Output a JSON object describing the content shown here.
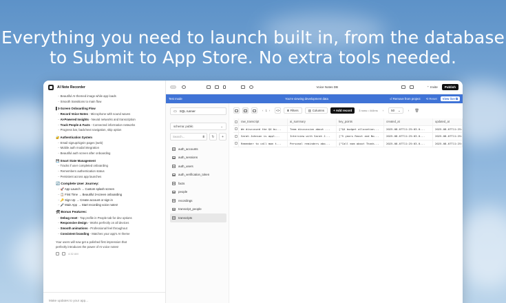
{
  "headline": {
    "line1": "Everything you need to launch built in, from the database",
    "line2": "to Submit to App Store. No extra tools needed."
  },
  "chat": {
    "app_name": "AI Note Recorder",
    "lines": [
      {
        "type": "sub",
        "text": "Beautiful AI-themed image while app loads"
      },
      {
        "type": "sub",
        "text": "Smooth transitions to main flow"
      },
      {
        "type": "head",
        "text": "▌3-Screen Onboarding Flow"
      },
      {
        "type": "sub",
        "bold": "Record Voice Notes",
        "text": " - Microphone with sound waves"
      },
      {
        "type": "sub",
        "bold": "AI-Powered Insights",
        "text": " - Neural networks and transcription"
      },
      {
        "type": "sub",
        "bold": "Track People & Facts",
        "text": " - Connected information networks"
      },
      {
        "type": "sub",
        "text": "Progress bar, back/next navigation, skip option"
      },
      {
        "type": "head",
        "text": "🔐 Authentication System"
      },
      {
        "type": "sub",
        "text": "Email signup/signin pages (web)"
      },
      {
        "type": "sub",
        "text": "Mobile auth modal integration"
      },
      {
        "type": "sub",
        "text": "Beautiful auth screen after onboarding"
      },
      {
        "type": "head",
        "text": "💾 Smart State Management"
      },
      {
        "type": "sub",
        "text": "Tracks if user completed onboarding"
      },
      {
        "type": "sub",
        "text": "Remembers authentication status"
      },
      {
        "type": "sub",
        "text": "Persistent across app launches"
      },
      {
        "type": "headbig",
        "text": "🔄 Complete User Journey:"
      },
      {
        "type": "sub",
        "text": "🚀 App Launch → Custom splash screen",
        "boldLead": true
      },
      {
        "type": "sub",
        "text": "📋 First Time → Beautiful 3-screen onboarding",
        "boldLead": true
      },
      {
        "type": "sub",
        "text": "🔑 Sign Up → Create account or sign in",
        "boldLead": true
      },
      {
        "type": "sub",
        "text": "🎤 Main App → Start recording voice notes!",
        "boldLead": true
      },
      {
        "type": "headbig",
        "text": "🛠 Bonus Features:"
      },
      {
        "type": "sub",
        "bold": "Debug reset",
        "text": " - Tap profile in People tab for dev options"
      },
      {
        "type": "sub",
        "bold": "Responsive design",
        "text": " - Works perfectly on all devices"
      },
      {
        "type": "sub",
        "bold": "Smooth animations",
        "text": " - Professional feel throughout"
      },
      {
        "type": "sub",
        "bold": "Consistent branding",
        "text": " - Matches your app's AI theme"
      },
      {
        "type": "plain",
        "text": "Your users will now get a polished first impression that"
      },
      {
        "type": "plain",
        "text": "perfectly introduces the power of AI voice notes!"
      }
    ],
    "time": "4:32 AM",
    "input_placeholder": "Make updates to your app..."
  },
  "topbar": {
    "title": "Voice Notes DB",
    "invite_label": "Invite",
    "publish_label": "Publish"
  },
  "testbar": {
    "mode_label": "Test mode",
    "message": "You're viewing development data",
    "remove_label": "Remove from project",
    "reset_label": "Reset",
    "view_live_label": "View live"
  },
  "sidebar": {
    "sql_label": "SQL runner",
    "schema_label": "schema: public",
    "search_placeholder": "Search...",
    "tables": [
      "auth_accounts",
      "auth_sessions",
      "auth_users",
      "auth_verification_token",
      "facts",
      "people",
      "recordings",
      "transcript_people",
      "transcripts"
    ],
    "active_table": "transcripts"
  },
  "toolbar": {
    "pager_text": "1",
    "filters_label": "Filters",
    "columns_label": "Columns",
    "add_record_label": "Add record",
    "row_info": "3 rows • 444ms",
    "page_size": "50"
  },
  "grid": {
    "columns": [
      "raw_transcript",
      "ai_summary",
      "key_points",
      "created_at",
      "updated_at"
    ],
    "rows": [
      [
        "We discussed the Q4 bu...",
        "Team discussion about ...",
        "[\"Q4 budget allocation...",
        "2025-08-07T11:25:03.0...",
        "2025-08-07T11:25:"
      ],
      [
        "Sarah Johnson is appl...",
        "Interview with Sarah J...",
        "[\"5 years React and No...",
        "2025-08-07T11:25:03.0...",
        "2025-08-07T11:25:"
      ],
      [
        "Remember to call mom t...",
        "Personal reminders abo...",
        "[\"Call mom about Thank...",
        "2025-08-07T11:25:03.0...",
        "2025-08-07T11:25:"
      ]
    ]
  },
  "colors": {
    "accent_blue": "#3f73d6",
    "dark": "#111111"
  }
}
